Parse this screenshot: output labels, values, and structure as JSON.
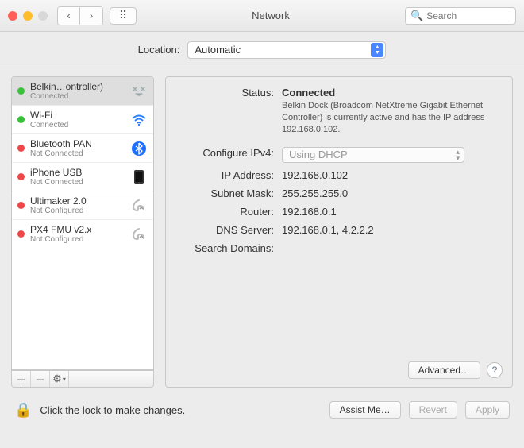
{
  "window": {
    "title": "Network",
    "search_placeholder": "Search"
  },
  "location": {
    "label": "Location:",
    "value": "Automatic"
  },
  "services": [
    {
      "name": "Belkin…ontroller)",
      "status": "Connected",
      "dot": "green",
      "icon": "ethernet"
    },
    {
      "name": "Wi-Fi",
      "status": "Connected",
      "dot": "green",
      "icon": "wifi"
    },
    {
      "name": "Bluetooth PAN",
      "status": "Not Connected",
      "dot": "red",
      "icon": "bluetooth"
    },
    {
      "name": "iPhone USB",
      "status": "Not Connected",
      "dot": "red",
      "icon": "iphone"
    },
    {
      "name": "Ultimaker 2.0",
      "status": "Not Configured",
      "dot": "red",
      "icon": "modem"
    },
    {
      "name": "PX4 FMU v2.x",
      "status": "Not Configured",
      "dot": "red",
      "icon": "modem"
    }
  ],
  "detail": {
    "labels": {
      "status": "Status:",
      "configure": "Configure IPv4:",
      "ip": "IP Address:",
      "subnet": "Subnet Mask:",
      "router": "Router:",
      "dns": "DNS Server:",
      "search": "Search Domains:"
    },
    "status_value": "Connected",
    "status_desc": "Belkin Dock (Broadcom NetXtreme Gigabit Ethernet Controller) is currently active and has the IP address 192.168.0.102.",
    "configure_value": "Using DHCP",
    "ip": "192.168.0.102",
    "subnet": "255.255.255.0",
    "router": "192.168.0.1",
    "dns": "192.168.0.1, 4.2.2.2",
    "search": ""
  },
  "buttons": {
    "advanced": "Advanced…",
    "assist": "Assist Me…",
    "revert": "Revert",
    "apply": "Apply"
  },
  "footer_text": "Click the lock to make changes."
}
